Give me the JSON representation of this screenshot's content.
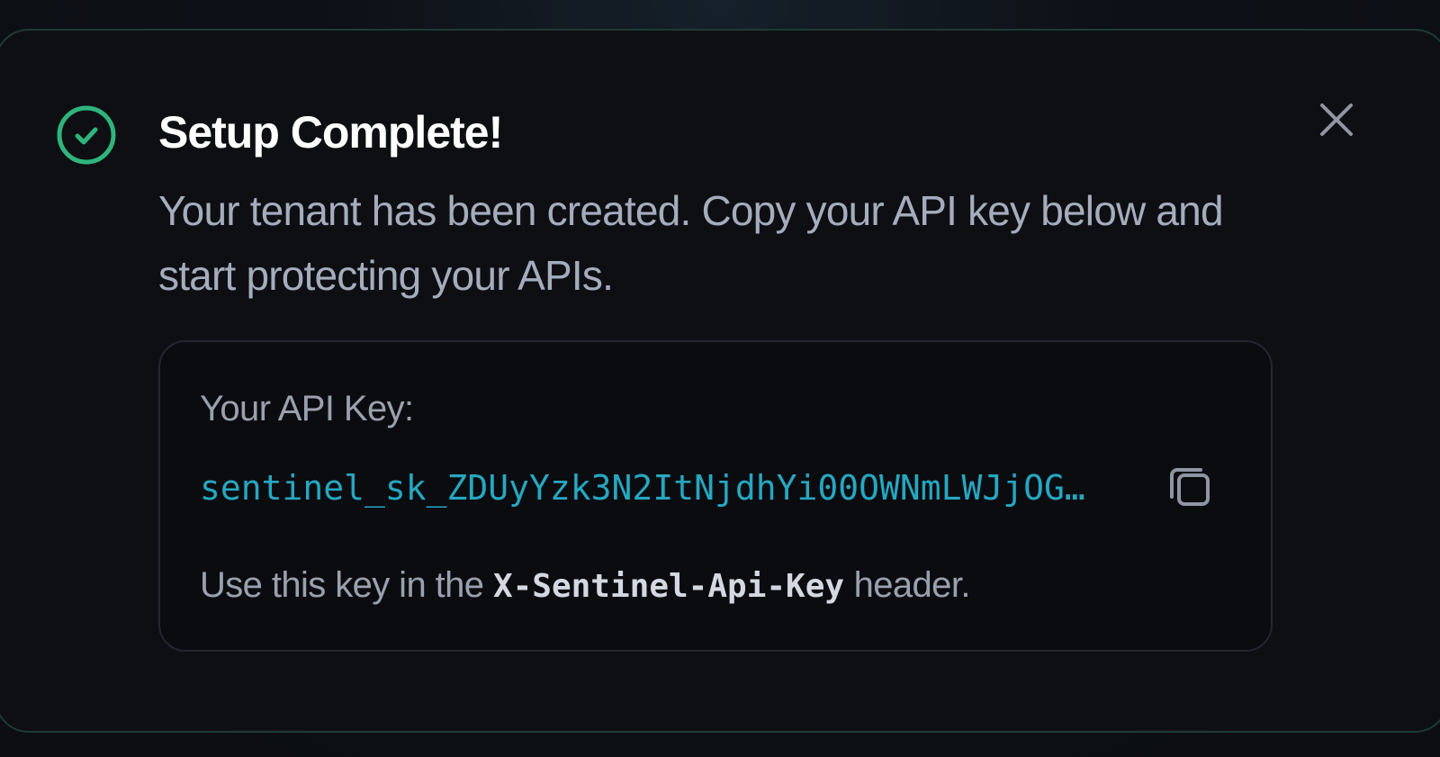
{
  "toast": {
    "title": "Setup Complete!",
    "description": "Your tenant has been created. Copy your API key below and start protecting your APIs.",
    "status_icon": "check-circle-icon",
    "close_icon": "close-icon",
    "accent_color": "#2fb47d"
  },
  "api_key": {
    "label": "Your API Key:",
    "value": "sentinel_sk_ZDUyYzk3N2ItNjdhYi00OWNmLWJjOG…",
    "value_color": "#26a7c0",
    "copy_icon": "copy-icon",
    "hint_prefix": "Use this key in the ",
    "hint_header": "X-Sentinel-Api-Key",
    "hint_suffix": " header."
  }
}
